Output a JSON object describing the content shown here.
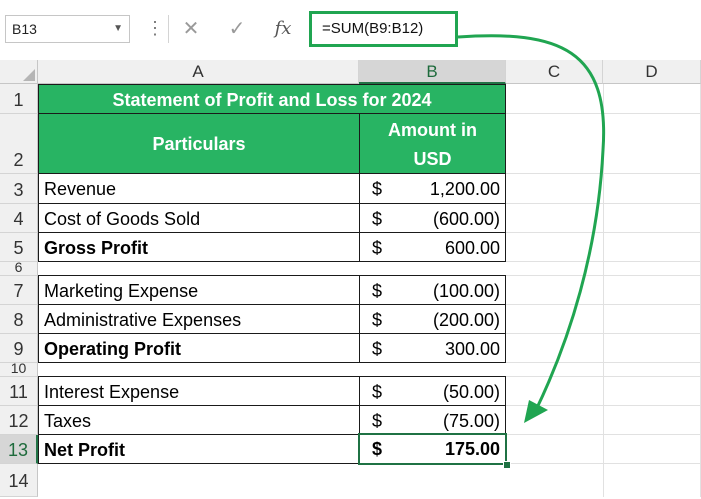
{
  "formula_bar": {
    "name_box": "B13",
    "formula": "=SUM(B9:B12)",
    "cancel_icon": "cancel-x-icon",
    "enter_icon": "check-icon",
    "fx_label": "fx"
  },
  "columns": [
    "A",
    "B",
    "C",
    "D"
  ],
  "rows": [
    "1",
    "2",
    "3",
    "4",
    "5",
    "6",
    "7",
    "8",
    "9",
    "10",
    "11",
    "12",
    "13",
    "14"
  ],
  "sheet": {
    "title": "Statement of Profit and Loss for 2024",
    "header_particulars": "Particulars",
    "header_amount_line1": "Amount in",
    "header_amount_line2": "USD",
    "items": [
      {
        "row": "3",
        "label": "Revenue",
        "cur": "$",
        "value": "1,200.00"
      },
      {
        "row": "4",
        "label": "Cost of Goods Sold",
        "cur": "$",
        "value": "(600.00)"
      },
      {
        "row": "5",
        "label": "Gross Profit",
        "cur": "$",
        "value": "600.00"
      },
      {
        "row": "7",
        "label": "Marketing Expense",
        "cur": "$",
        "value": "(100.00)"
      },
      {
        "row": "8",
        "label": "Administrative Expenses",
        "cur": "$",
        "value": "(200.00)"
      },
      {
        "row": "9",
        "label": "Operating Profit",
        "cur": "$",
        "value": "300.00"
      },
      {
        "row": "11",
        "label": "Interest Expense",
        "cur": "$",
        "value": "(50.00)"
      },
      {
        "row": "12",
        "label": "Taxes",
        "cur": "$",
        "value": "(75.00)"
      },
      {
        "row": "13",
        "label": "Net Profit",
        "cur": "$",
        "value": "175.00"
      }
    ]
  },
  "colors": {
    "header_green": "#28b463",
    "highlight_green": "#20a551",
    "selection": "#1f7244"
  }
}
